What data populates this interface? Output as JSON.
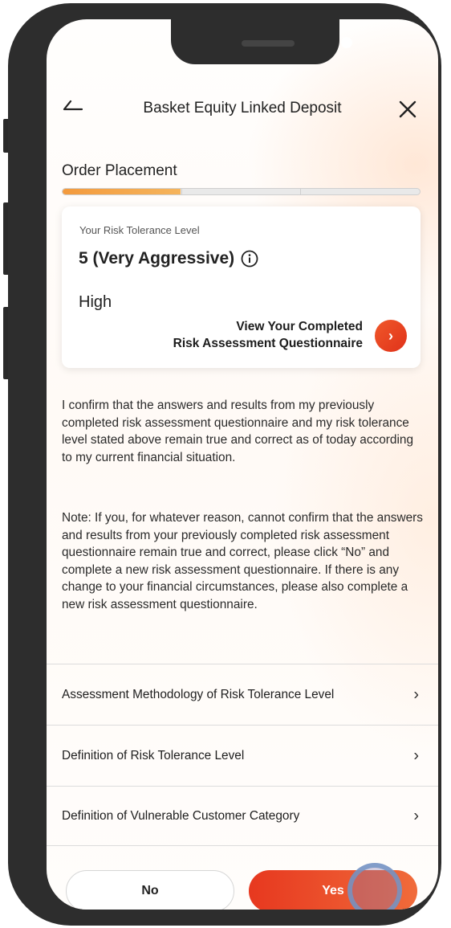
{
  "header": {
    "title": "Basket Equity Linked Deposit",
    "back_icon": "back-arrow-icon",
    "close_icon": "close-icon"
  },
  "section": {
    "title": "Order Placement",
    "progress_fraction": 0.33
  },
  "risk_card": {
    "label": "Your Risk Tolerance Level",
    "level": "5 (Very Aggressive)",
    "value": "High",
    "view_link_line1": "View Your Completed",
    "view_link_line2": "Risk Assessment Questionnaire",
    "arrow": "›"
  },
  "confirm_text": "I confirm that the answers and results from my previously completed risk assessment questionnaire and my risk tolerance level stated above remain true and correct as of today according to my current financial situation.",
  "note_text": "Note: If you, for whatever reason, cannot confirm that the answers and results from your previously completed risk assessment questionnaire remain true and correct, please click “No” and complete a new risk assessment questionnaire. If there is any change to your financial circumstances, please also complete a new risk assessment questionnaire.",
  "links": [
    {
      "label": "Assessment Methodology of Risk Tolerance Level",
      "chevron": "›"
    },
    {
      "label": "Definition of Risk Tolerance Level",
      "chevron": "›"
    },
    {
      "label": "Definition of Vulnerable Customer Category",
      "chevron": "›"
    }
  ],
  "buttons": {
    "no_label": "No",
    "yes_label": "Yes"
  },
  "colors": {
    "accent": "#e7381f",
    "progress": "#f39a3d",
    "frame": "#2d2d2d"
  }
}
